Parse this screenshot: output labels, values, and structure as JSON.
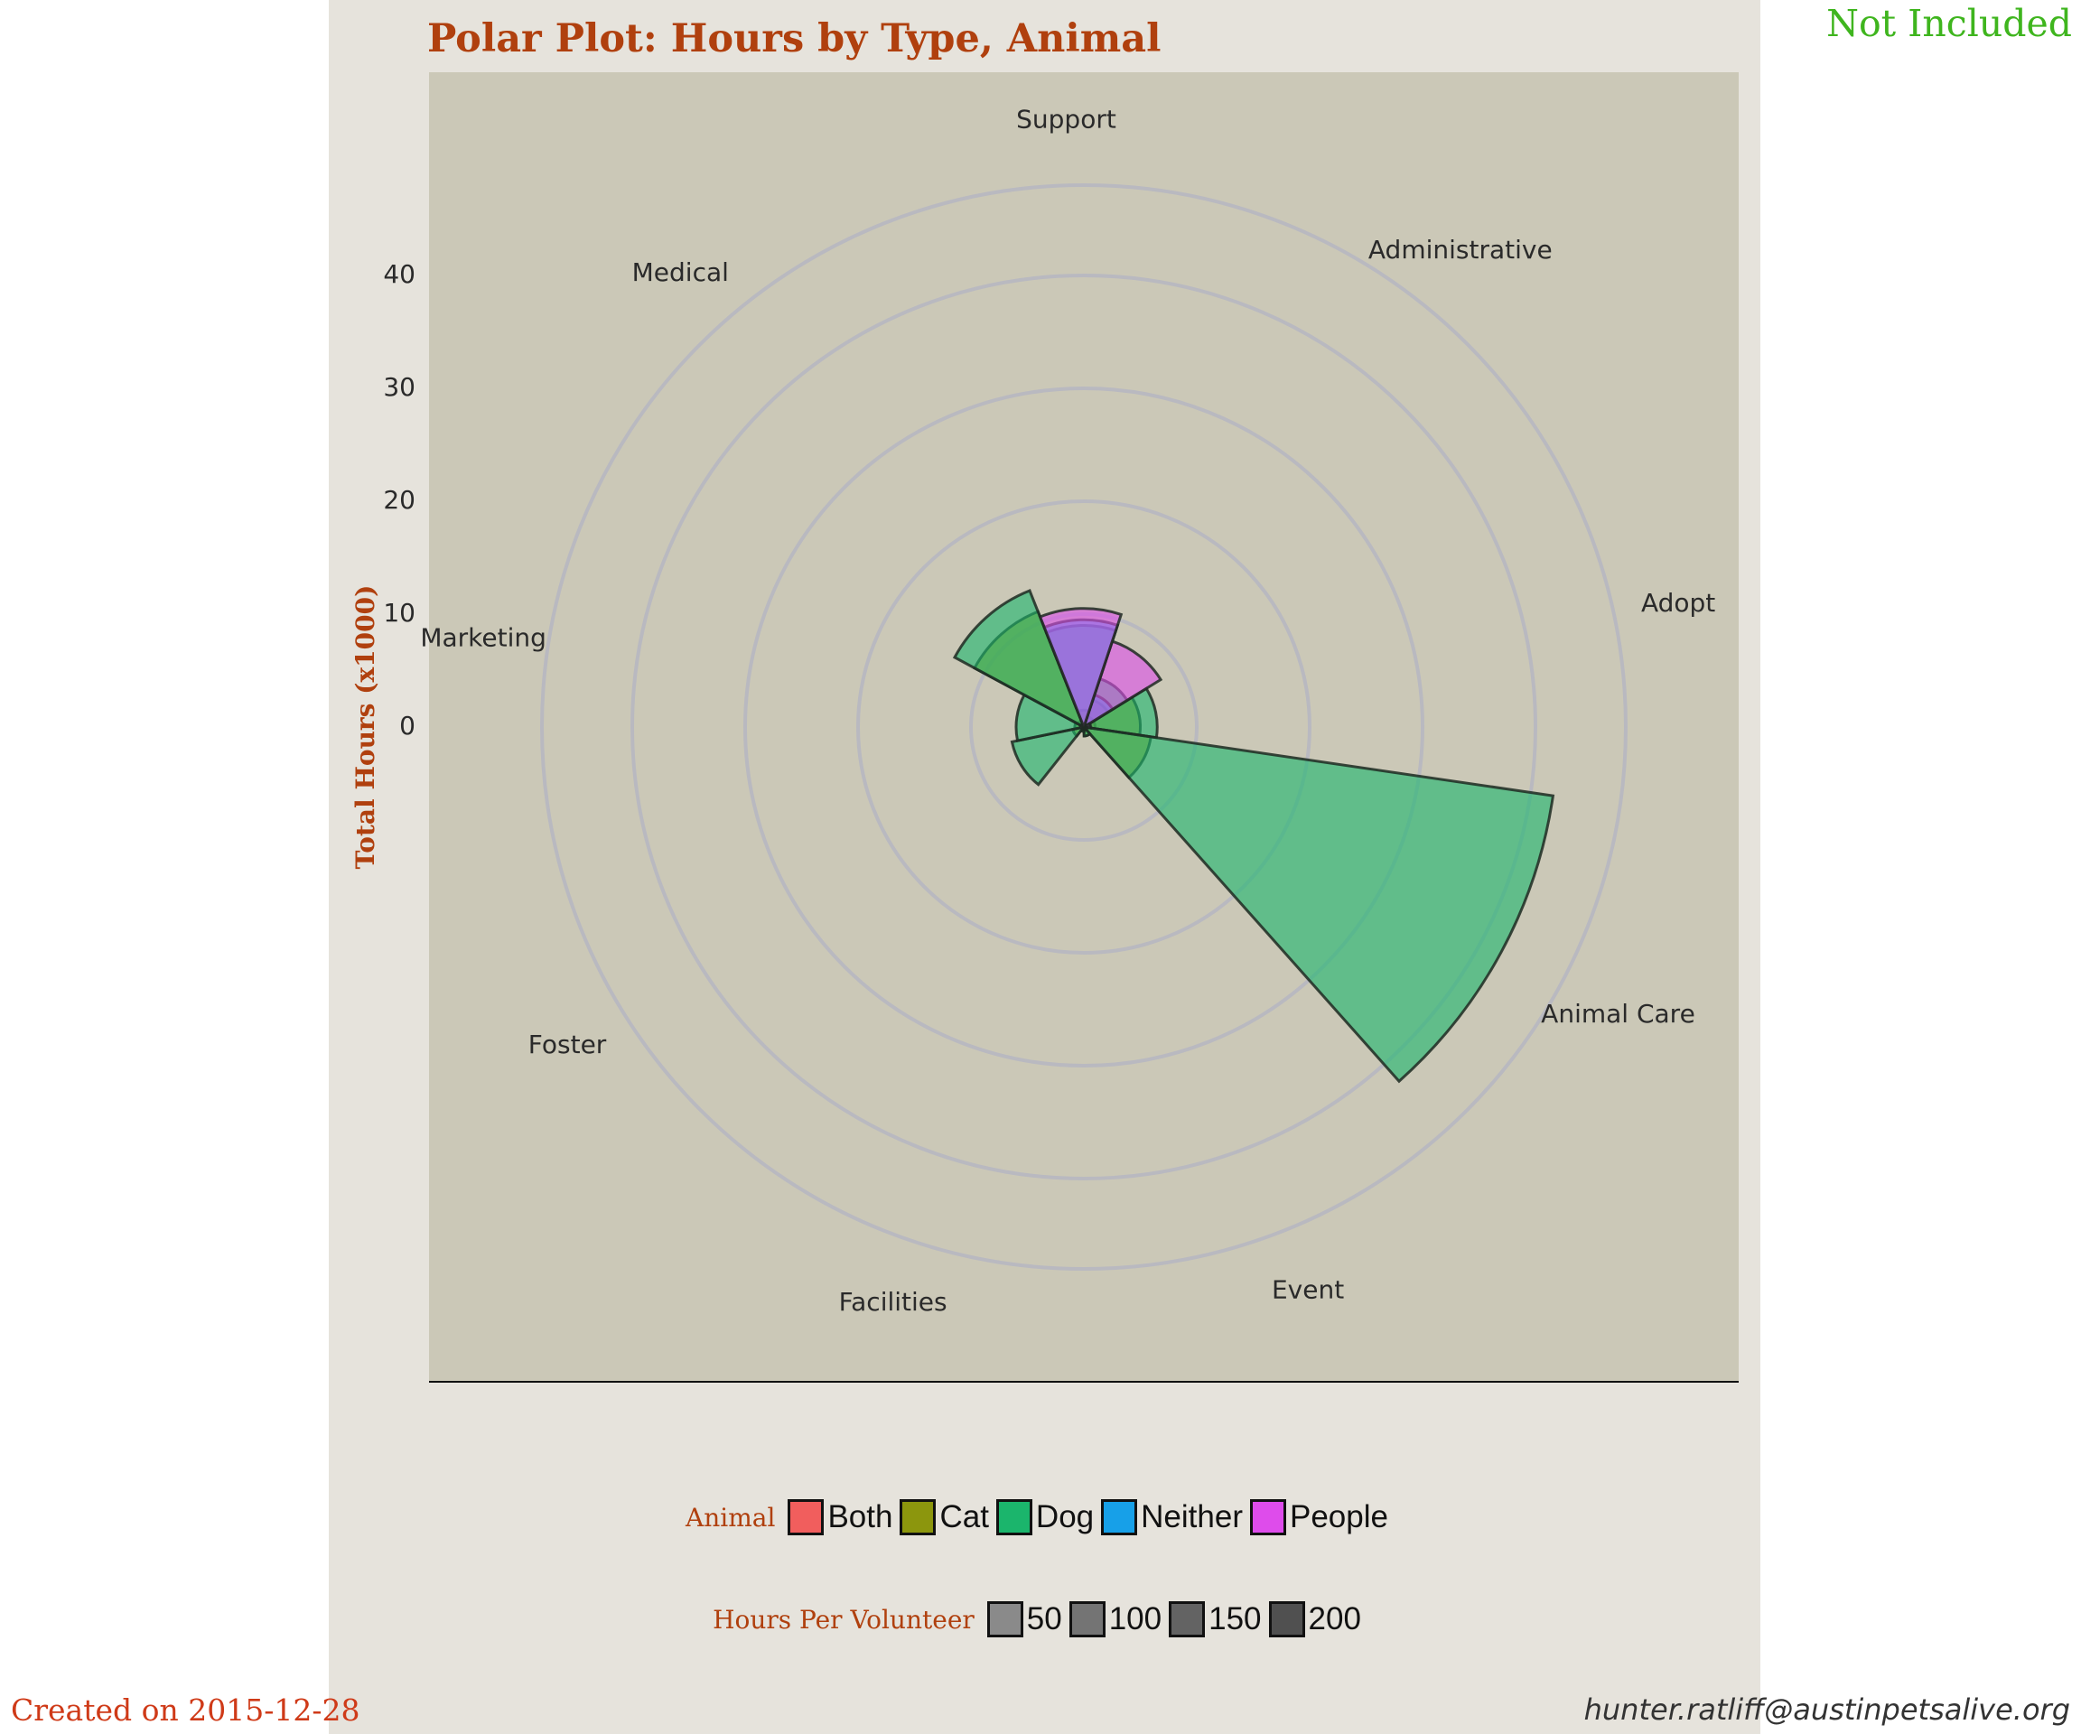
{
  "corner": {
    "top_right": "Not Included",
    "bottom_left": "Created on 2015-12-28",
    "bottom_right": "hunter.ratliff@austinpetsalive.org"
  },
  "chart_data": {
    "type": "polar_bar",
    "title": "Polar Plot: Hours by Type, Animal",
    "ylabel": "Total Hours (x1000)",
    "rlim": [
      0,
      48
    ],
    "r_ticks": [
      0,
      10,
      20,
      30,
      40
    ],
    "grid": true,
    "categories": [
      "Administrative",
      "Adopt",
      "Animal Care",
      "Event",
      "Facilities",
      "Foster",
      "Marketing",
      "Medical",
      "Support"
    ],
    "series": [
      {
        "name": "Both",
        "color": "#f15e5d",
        "values": [
          2.5,
          1.0,
          0.3,
          0.2,
          0.2,
          0.2,
          0.3,
          0.6,
          0.3
        ]
      },
      {
        "name": "Cat",
        "color": "#8c960d",
        "values": [
          1.0,
          5.0,
          6.0,
          0.8,
          0.2,
          1.0,
          0.8,
          11.0,
          1.5
        ]
      },
      {
        "name": "Dog",
        "color": "#1bb56c",
        "values": [
          4.5,
          6.5,
          42.0,
          0.8,
          0.4,
          6.5,
          6.0,
          13.0,
          9.0
        ]
      },
      {
        "name": "Neither",
        "color": "#17a0e8",
        "values": [
          3.0,
          0.6,
          0.3,
          0.2,
          0.1,
          0.2,
          0.3,
          0.2,
          9.5
        ]
      },
      {
        "name": "People",
        "color": "#de4ceb",
        "values": [
          8.0,
          0.5,
          0.3,
          0.2,
          0.1,
          0.2,
          0.3,
          0.2,
          10.5
        ]
      }
    ]
  },
  "legend": {
    "animal_title": "Animal",
    "animal_items": [
      {
        "label": "Both",
        "color": "#f15e5d"
      },
      {
        "label": "Cat",
        "color": "#8c960d"
      },
      {
        "label": "Dog",
        "color": "#1bb56c"
      },
      {
        "label": "Neither",
        "color": "#17a0e8"
      },
      {
        "label": "People",
        "color": "#de4ceb"
      }
    ],
    "hours_title": "Hours Per Volunteer",
    "hours_items": [
      {
        "label": "50",
        "color": "#8a8a8a"
      },
      {
        "label": "100",
        "color": "#747474"
      },
      {
        "label": "150",
        "color": "#636363"
      },
      {
        "label": "200",
        "color": "#505050"
      }
    ]
  }
}
